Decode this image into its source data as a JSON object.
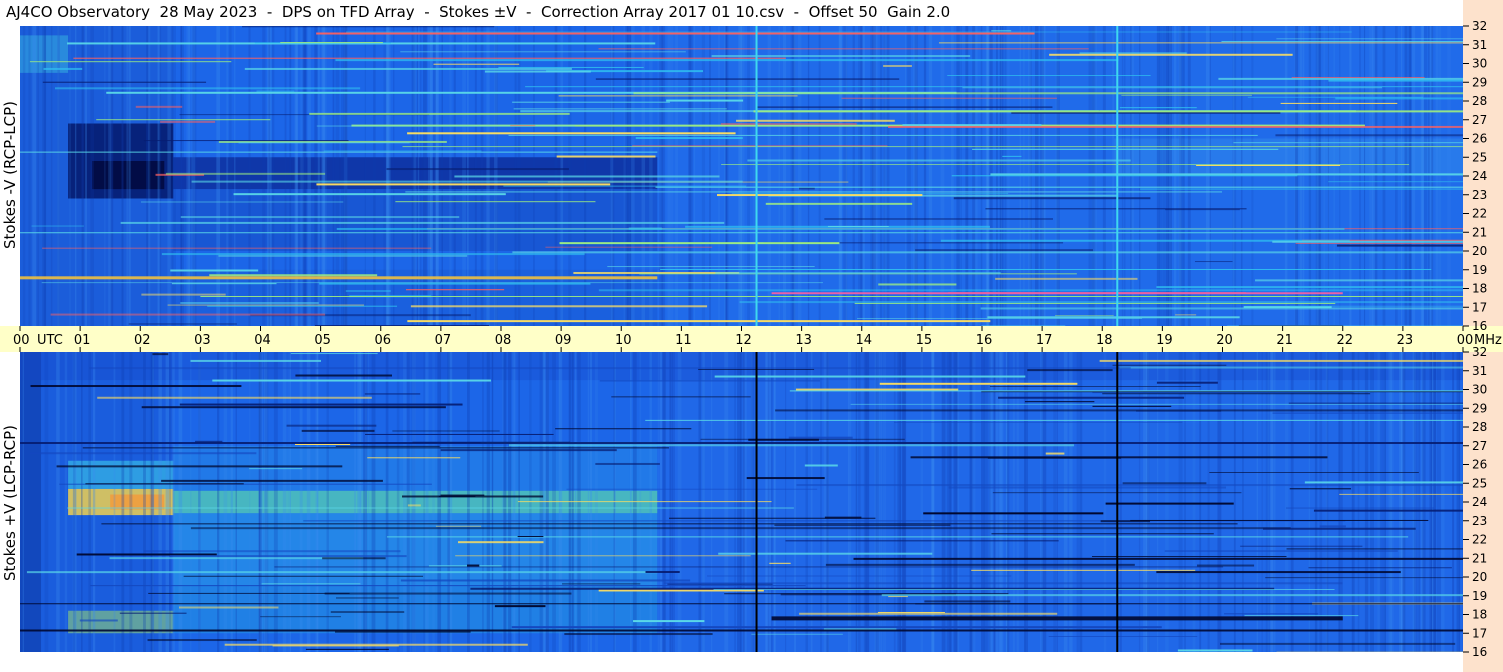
{
  "title": "AJ4CO Observatory  28 May 2023  -  DPS on TFD Array  -  Stokes ±V  -  Correction Array 2017 01 10.csv  -  Offset 50  Gain 2.0",
  "colors": {
    "background_blue": "#1c66e8",
    "axis_strip": "#ffffc8",
    "right_strip": "#fde2cc"
  },
  "chart_data": [
    {
      "type": "heatmap",
      "ylabel": "Stokes -V (RCP-LCP)",
      "x_unit": "UTC",
      "y_unit": "MHz",
      "xlim": [
        0,
        24
      ],
      "ylim": [
        16,
        32
      ],
      "x_ticks": [
        "00",
        "01",
        "02",
        "03",
        "04",
        "05",
        "06",
        "07",
        "08",
        "09",
        "10",
        "11",
        "12",
        "13",
        "14",
        "15",
        "16",
        "17",
        "18",
        "19",
        "20",
        "21",
        "22",
        "23",
        "00"
      ],
      "y_ticks": [
        "32",
        "31",
        "30",
        "29",
        "28",
        "27",
        "26",
        "25",
        "24",
        "23",
        "22",
        "21",
        "20",
        "19",
        "18",
        "17",
        "16"
      ],
      "colormap": "jet"
    },
    {
      "type": "heatmap",
      "ylabel": "Stokes +V (LCP-RCP)",
      "x_unit": "UTC",
      "y_unit": "MHz",
      "xlim": [
        0,
        24
      ],
      "ylim": [
        16,
        32
      ],
      "x_ticks": [
        "00",
        "01",
        "02",
        "03",
        "04",
        "05",
        "06",
        "07",
        "08",
        "09",
        "10",
        "11",
        "12",
        "13",
        "14",
        "15",
        "16",
        "17",
        "18",
        "19",
        "20",
        "21",
        "22",
        "23",
        "00"
      ],
      "y_ticks": [
        "32",
        "31",
        "30",
        "29",
        "28",
        "27",
        "26",
        "25",
        "24",
        "23",
        "22",
        "21",
        "20",
        "19",
        "18",
        "17",
        "16"
      ],
      "colormap": "jet"
    }
  ]
}
